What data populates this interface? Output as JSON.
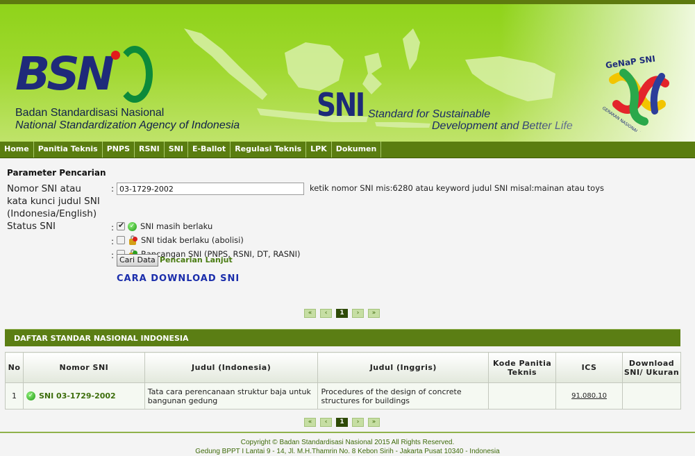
{
  "header": {
    "logo_text": "BSN",
    "agency_id": "Badan Standardisasi Nasional",
    "agency_en": "National Standardization Agency of Indonesia",
    "sni_logo": "SNI",
    "sni_tagline_1": "Standard for Sustainable",
    "sni_tagline_2": "Development and Better Life",
    "genap_logo": "GeNaP SNI",
    "genap_ring_text": "GERAKAN NASIONAL PENERAPAN SNI"
  },
  "nav": {
    "items": [
      "Home",
      "Panitia Teknis",
      "PNPS",
      "RSNI",
      "SNI",
      "E-Ballot",
      "Regulasi Teknis",
      "LPK",
      "Dokumen"
    ]
  },
  "search": {
    "title": "Parameter Pencarian",
    "nomor_label_1": "Nomor SNI atau",
    "nomor_label_2": "kata kunci judul SNI",
    "nomor_label_3": "(Indonesia/English)",
    "colon": ":",
    "input_value": "03-1729-2002",
    "hint": "ketik nomor SNI mis:6280 atau keyword judul SNI misal:mainan atau toys",
    "status_label": "Status SNI",
    "options": [
      {
        "label": "SNI masih berlaku",
        "checked": true,
        "icon": "check-circle-icon"
      },
      {
        "label": "SNI tidak berlaku (abolisi)",
        "checked": false,
        "icon": "lock-red-icon"
      },
      {
        "label": "Rancangan SNI (PNPS, RSNI, DT, RASNI)",
        "checked": false,
        "icon": "lock-green-icon"
      }
    ],
    "button_label": "Cari Data",
    "advanced_link": "Pencarian Lanjut",
    "download_link": "CARA DOWNLOAD SNI"
  },
  "pager": {
    "first": "«",
    "prev": "‹",
    "current": "1",
    "next": "›",
    "last": "»"
  },
  "results": {
    "title": "DAFTAR STANDAR NASIONAL INDONESIA",
    "columns": [
      "No",
      "Nomor SNI",
      "Judul (Indonesia)",
      "Judul (Inggris)",
      "Kode Panitia Teknis",
      "ICS",
      "Download SNI/ Ukuran"
    ],
    "rows": [
      {
        "no": "1",
        "nomor": "SNI 03-1729-2002",
        "judul_id": "Tata cara perencanaan struktur baja untuk bangunan gedung",
        "judul_en": "Procedures of the design of concrete structures for buildings",
        "kode": "",
        "ics": "91.080.10",
        "download": ""
      }
    ]
  },
  "footer": {
    "line1": "Copyright © Badan Standardisasi Nasional 2015 All Rights Reserved.",
    "line2": "Gedung BPPT I Lantai 9 - 14, Jl. M.H.Thamrin No. 8 Kebon Sirih - Jakarta Pusat 10340 - Indonesia"
  },
  "colors": {
    "header_green": "#8fd31a",
    "nav_green": "#5a7d10",
    "link_blue": "#1a2dab"
  }
}
